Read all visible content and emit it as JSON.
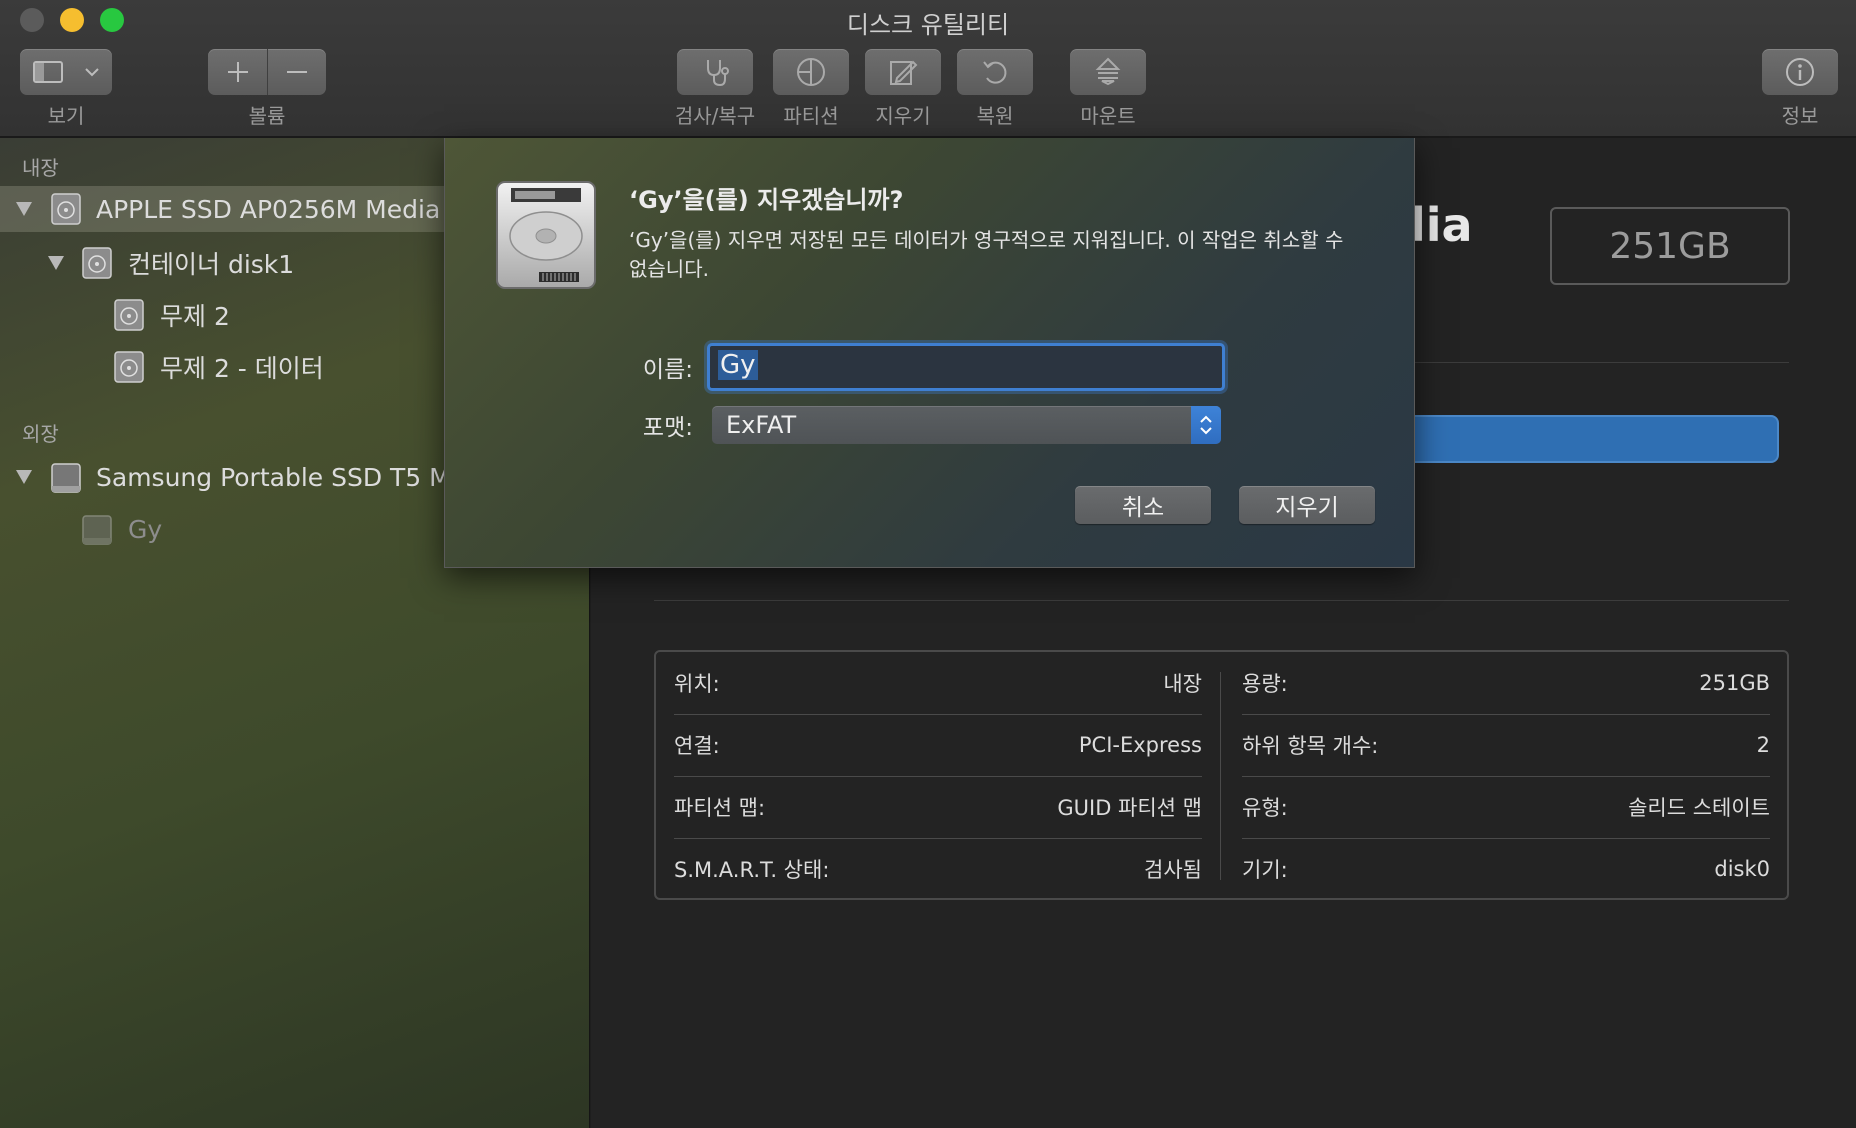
{
  "window": {
    "title": "디스크 유틸리티"
  },
  "toolbar": {
    "view_label": "보기",
    "volume_label": "볼륨",
    "firstaid_label": "검사/복구",
    "partition_label": "파티션",
    "erase_label": "지우기",
    "restore_label": "복원",
    "mount_label": "마운트",
    "info_label": "정보"
  },
  "sidebar": {
    "internal_header": "내장",
    "external_header": "외장",
    "internal_items": [
      {
        "label": "APPLE SSD AP0256M Media"
      },
      {
        "label": "컨테이너 disk1"
      },
      {
        "label": "무제 2"
      },
      {
        "label": "무제 2 - 데이터"
      }
    ],
    "external_items": [
      {
        "label": "Samsung Portable SSD T5 M"
      },
      {
        "label": "Gy"
      }
    ]
  },
  "main": {
    "title_fragment": "lia",
    "capacity_badge": "251GB",
    "info": {
      "left": [
        {
          "key": "위치:",
          "value": "내장"
        },
        {
          "key": "연결:",
          "value": "PCI-Express"
        },
        {
          "key": "파티션 맵:",
          "value": "GUID 파티션 맵"
        },
        {
          "key": "S.M.A.R.T. 상태:",
          "value": "검사됨"
        }
      ],
      "right": [
        {
          "key": "용량:",
          "value": "251GB"
        },
        {
          "key": "하위 항목 개수:",
          "value": "2"
        },
        {
          "key": "유형:",
          "value": "솔리드 스테이트"
        },
        {
          "key": "기기:",
          "value": "disk0"
        }
      ]
    }
  },
  "dialog": {
    "title": "‘Gy’을(를) 지우겠습니까?",
    "message": "‘Gy’을(를) 지우면 저장된 모든 데이터가 영구적으로 지워집니다. 이 작업은 취소할 수 없습니다.",
    "name_label": "이름:",
    "name_value": "Gy",
    "format_label": "포맷:",
    "format_value": "ExFAT",
    "cancel_label": "취소",
    "erase_label": "지우기"
  },
  "colors": {
    "accent": "#3f7fd1",
    "traffic_close": "#5b5b5b",
    "traffic_minimize": "#f6be2f",
    "traffic_maximize": "#28c840"
  },
  "icons": [
    "sidebar-toggle-icon",
    "chevron-down-icon",
    "plus-icon",
    "minus-icon",
    "stethoscope-icon",
    "partition-icon",
    "erase-icon",
    "restore-icon",
    "mount-icon",
    "info-icon",
    "internal-disk-icon",
    "external-disk-icon",
    "hard-drive-icon",
    "stepper-arrows-icon"
  ]
}
